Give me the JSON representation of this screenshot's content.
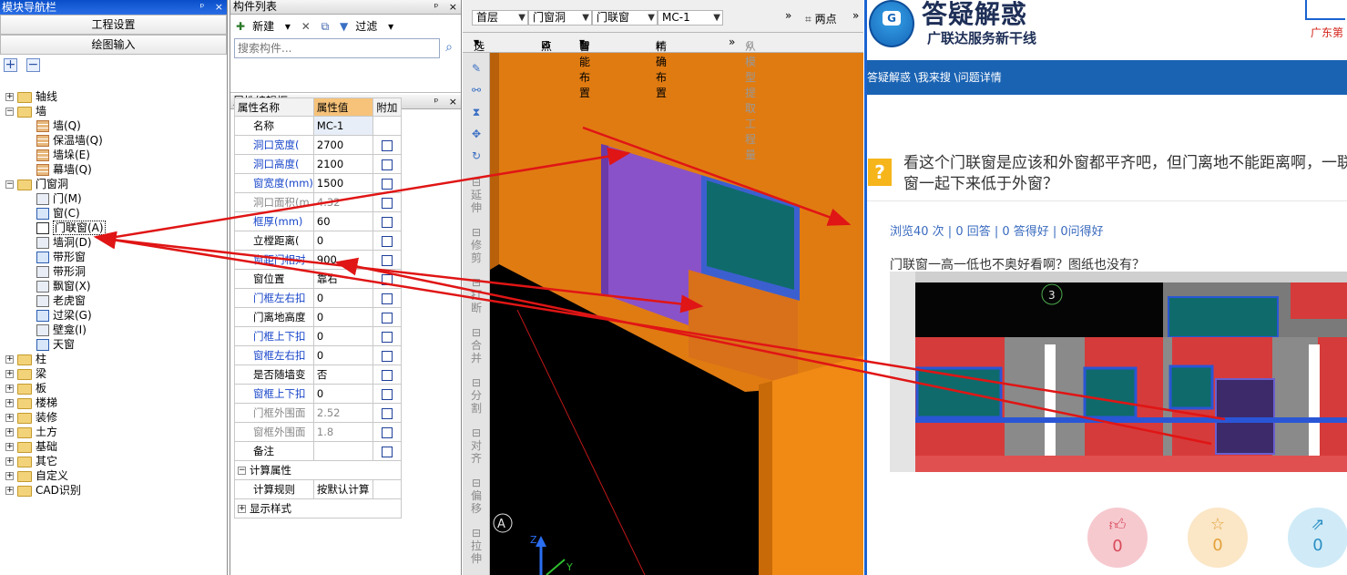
{
  "nav_panel": {
    "title": "模块导航栏",
    "title_buttons": [
      "ᵖ",
      "×"
    ],
    "btn_project_settings": "工程设置",
    "btn_drawing_input": "绘图输入",
    "tree": [
      {
        "label": "轴线",
        "level": 0,
        "expanded": false
      },
      {
        "label": "墙",
        "level": 0,
        "expanded": true
      },
      {
        "label": "墙(Q)",
        "level": 1,
        "icon": "wall-icon"
      },
      {
        "label": "保温墙(Q)",
        "level": 1,
        "icon": "insulation-wall-icon"
      },
      {
        "label": "墙垛(E)",
        "level": 1,
        "icon": "wall-pier-icon"
      },
      {
        "label": "幕墙(Q)",
        "level": 1,
        "icon": "curtain-wall-icon"
      },
      {
        "label": "门窗洞",
        "level": 0,
        "expanded": true
      },
      {
        "label": "门(M)",
        "level": 1,
        "icon": "door-icon"
      },
      {
        "label": "窗(C)",
        "level": 1,
        "icon": "window-icon"
      },
      {
        "label": "门联窗(A)",
        "level": 1,
        "icon": "door-window-icon",
        "selected": true
      },
      {
        "label": "墙洞(D)",
        "level": 1,
        "icon": "wall-opening-icon"
      },
      {
        "label": "带形窗",
        "level": 1,
        "icon": "strip-window-icon"
      },
      {
        "label": "带形洞",
        "level": 1,
        "icon": "strip-opening-icon"
      },
      {
        "label": "飘窗(X)",
        "level": 1,
        "icon": "bay-window-icon"
      },
      {
        "label": "老虎窗",
        "level": 1,
        "icon": "dormer-window-icon"
      },
      {
        "label": "过梁(G)",
        "level": 1,
        "icon": "lintel-icon"
      },
      {
        "label": "壁龛(I)",
        "level": 1,
        "icon": "niche-icon"
      },
      {
        "label": "天窗",
        "level": 1,
        "icon": "skylight-icon"
      },
      {
        "label": "柱",
        "level": 0,
        "expanded": false
      },
      {
        "label": "梁",
        "level": 0,
        "expanded": false
      },
      {
        "label": "板",
        "level": 0,
        "expanded": false
      },
      {
        "label": "楼梯",
        "level": 0,
        "expanded": false
      },
      {
        "label": "装修",
        "level": 0,
        "expanded": false
      },
      {
        "label": "土方",
        "level": 0,
        "expanded": false
      },
      {
        "label": "基础",
        "level": 0,
        "expanded": false
      },
      {
        "label": "其它",
        "level": 0,
        "expanded": false
      },
      {
        "label": "自定义",
        "level": 0,
        "expanded": false
      },
      {
        "label": "CAD识别",
        "level": 0,
        "expanded": false
      }
    ]
  },
  "component_list": {
    "title": "构件列表",
    "title_buttons": [
      "ᵖ",
      "×"
    ],
    "new_label": "新建",
    "filter_label": "过滤",
    "search_placeholder": "搜索构件..."
  },
  "property_editor": {
    "title": "属性编辑框",
    "title_buttons": [
      "ᵖ",
      "×"
    ],
    "headers": [
      "属性名称",
      "属性值",
      "附加"
    ],
    "rows": [
      {
        "name": "名称",
        "value": "MC-1",
        "style": "normal",
        "check": false
      },
      {
        "name": "洞口宽度(",
        "value": "2700",
        "style": "blue",
        "check": true
      },
      {
        "name": "洞口高度(",
        "value": "2100",
        "style": "blue",
        "check": true
      },
      {
        "name": "窗宽度(mm)",
        "value": "1500",
        "style": "blue",
        "check": true
      },
      {
        "name": "洞口面积(m",
        "value": "4.32",
        "style": "gray",
        "check": true
      },
      {
        "name": "框厚(mm)",
        "value": "60",
        "style": "blue",
        "check": true
      },
      {
        "name": "立樘距离(",
        "value": "0",
        "style": "normal",
        "check": true
      },
      {
        "name": "窗距门相对",
        "value": "900",
        "style": "blue",
        "check": true
      },
      {
        "name": "窗位置",
        "value": "靠右",
        "style": "normal",
        "check": true
      },
      {
        "name": "门框左右扣",
        "value": "0",
        "style": "blue",
        "check": true
      },
      {
        "name": "门离地高度",
        "value": "0",
        "style": "normal",
        "check": true
      },
      {
        "name": "门框上下扣",
        "value": "0",
        "style": "blue",
        "check": true
      },
      {
        "name": "窗框左右扣",
        "value": "0",
        "style": "blue",
        "check": true
      },
      {
        "name": "是否随墙变",
        "value": "否",
        "style": "normal",
        "check": true
      },
      {
        "name": "窗框上下扣",
        "value": "0",
        "style": "blue",
        "check": true
      },
      {
        "name": "门框外围面",
        "value": "2.52",
        "style": "gray",
        "check": true
      },
      {
        "name": "窗框外围面",
        "value": "1.8",
        "style": "gray",
        "check": true
      },
      {
        "name": "备注",
        "value": "",
        "style": "normal",
        "check": true
      }
    ],
    "group_calc": "计算属性",
    "calc_rule_label": "计算规则",
    "calc_rule_value": "按默认计算",
    "group_display": "显示样式"
  },
  "view_toolbar": {
    "combo_floor": "首层",
    "combo_category": "门窗洞",
    "combo_type": "门联窗",
    "combo_component": "MC-1",
    "more": "»",
    "two_points": "两点",
    "select_label": "选择",
    "point_label": "点",
    "smart_layout": "智能布置",
    "precise_layout": "精确布置",
    "extract_label": "从模型提取工程量"
  },
  "view_side_tools": [
    "延伸",
    "修剪",
    "打断",
    "合并",
    "分割",
    "对齐",
    "偏移",
    "拉伸"
  ],
  "view_axis_labels": {
    "a": "A",
    "z": "Z",
    "y": "Y",
    "three": "3"
  },
  "web": {
    "brand_title": "答疑解惑",
    "brand_sub": "广联达服务新干线",
    "topright": "广东第",
    "breadcrumb": "答疑解惑 \\我来搜 \\问题详情",
    "question": "看这个门联窗是应该和外窗都平齐吧，但门离地不能距离啊，一联窗一起下来低于外窗？",
    "question_icon": "?",
    "stats": "浏览40 次 | 0 回答 | 0 答得好 | 0问得好",
    "answer_text": "门联窗一高一低也不奥好看啊？图纸也没有？",
    "like_count": "0",
    "fav_count": "0",
    "share_count": "0",
    "like_color": "#f6c9cf",
    "fav_color": "#fbe6c6",
    "share_color": "#d0ebf7",
    "accent_blue": "#1a63b3"
  }
}
